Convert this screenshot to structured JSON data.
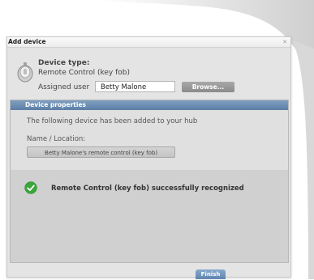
{
  "dialog": {
    "title": "Add device",
    "close_icon": "close-icon"
  },
  "device": {
    "type_label": "Device type:",
    "type_value": "Remote Control (key fob)",
    "icon": "key-fob-icon"
  },
  "assigned_user": {
    "label": "Assigned user",
    "value": "Betty Malone",
    "browse_label": "Browse..."
  },
  "properties": {
    "header": "Device properties",
    "info": "The following device has been added to your hub",
    "name_label": "Name / Location:",
    "name_value": "Betty Malone's remote control (key fob)"
  },
  "status": {
    "message": "Remote Control (key fob)  successfully recognized",
    "icon": "check-icon",
    "color": "#3aa53a"
  },
  "actions": {
    "finish_label": "Finish"
  },
  "colors": {
    "header_blue": "#5c7fa6",
    "button_gray": "#9a9a9a"
  }
}
